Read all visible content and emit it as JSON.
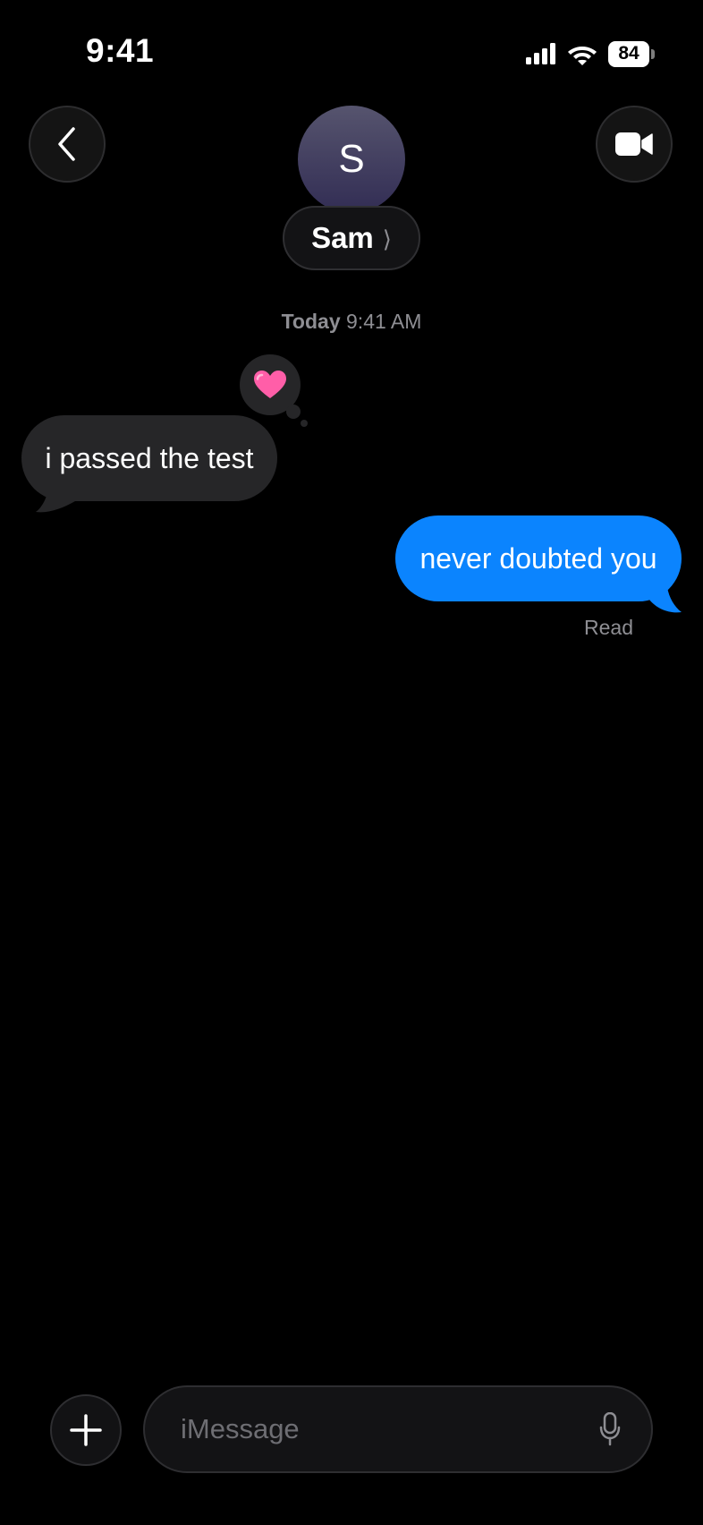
{
  "status_bar": {
    "time": "9:41",
    "battery_level": "84"
  },
  "header": {
    "avatar_initial": "S",
    "contact_name": "Sam",
    "chevron": "⟩"
  },
  "conversation": {
    "timestamp_day": "Today",
    "timestamp_time": "9:41 AM",
    "messages": [
      {
        "direction": "incoming",
        "text": "i passed the test",
        "tapback": "heart"
      },
      {
        "direction": "outgoing",
        "text": "never doubted you",
        "receipt": "Read"
      }
    ]
  },
  "input_bar": {
    "placeholder": "iMessage"
  },
  "icons": {
    "back": "chevron-left-icon",
    "video": "video-camera-icon",
    "signal": "cellular-signal-icon",
    "wifi": "wifi-icon",
    "add": "plus-icon",
    "mic": "microphone-icon",
    "tapback": "heart-icon"
  },
  "colors": {
    "background": "#000000",
    "incoming_bubble": "#262628",
    "outgoing_bubble": "#0b84fe",
    "secondary_text": "#8e8e93",
    "tapback_heart": "#ff5ea8"
  }
}
